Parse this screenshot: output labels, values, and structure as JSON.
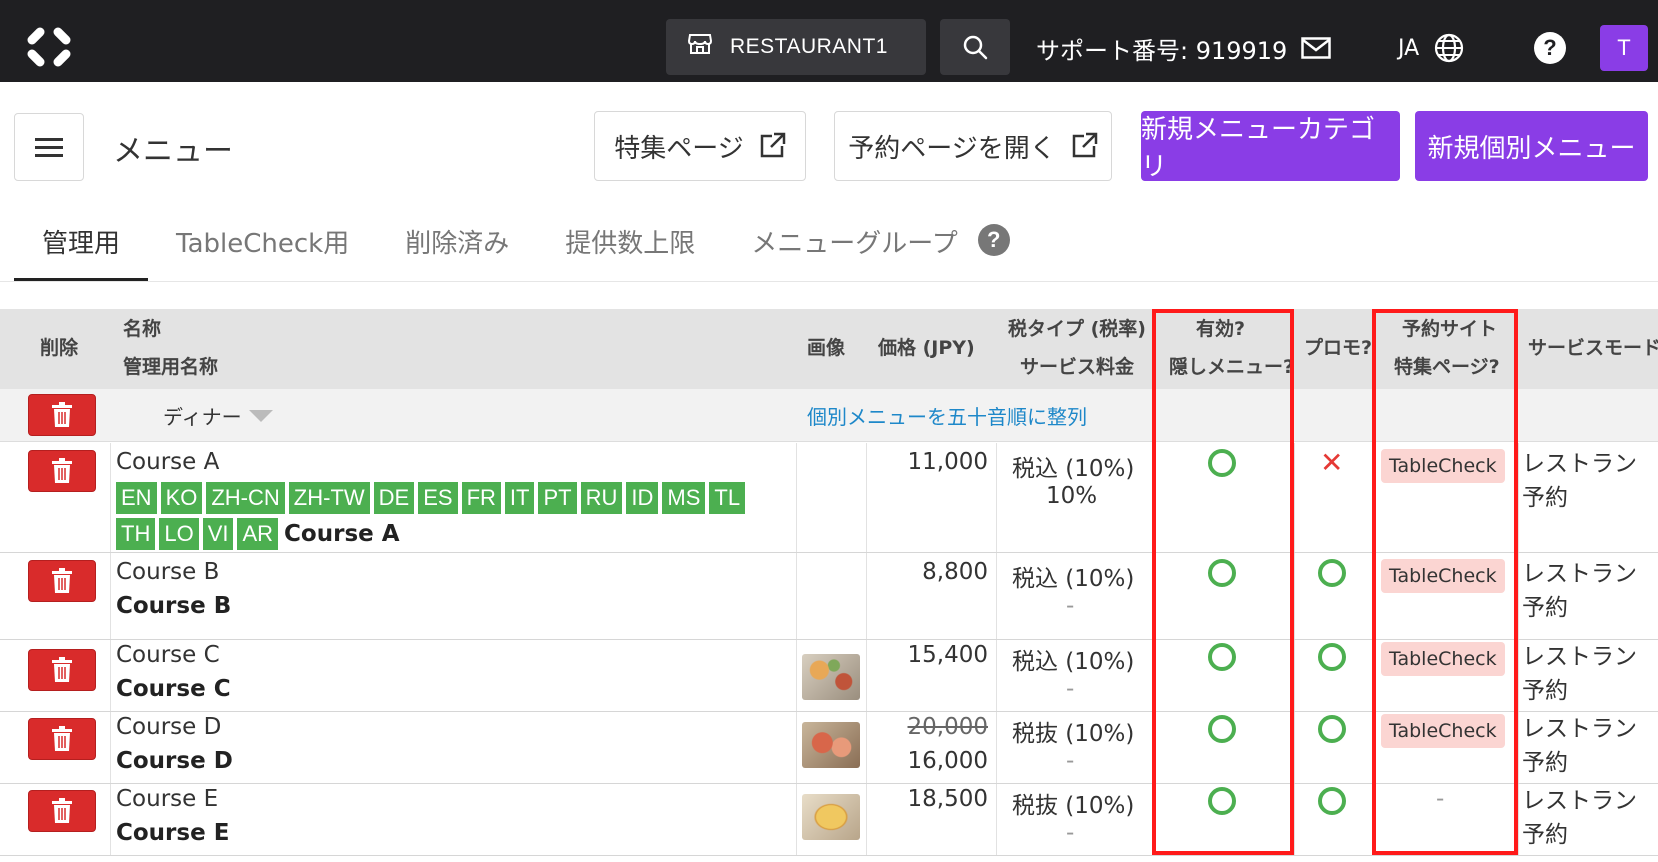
{
  "topbar": {
    "store": "RESTAURANT1",
    "support": "サポート番号: 919919",
    "lang": "JA",
    "help": "?",
    "avatar": "T"
  },
  "header": {
    "title": "メニュー",
    "feature_page": "特集ページ",
    "open_booking": "予約ページを開く",
    "new_category": "新規メニューカテゴリ",
    "new_item": "新規個別メニュー"
  },
  "tabs": [
    "管理用",
    "TableCheck用",
    "削除済み",
    "提供数上限",
    "メニューグループ"
  ],
  "tab_help": "?",
  "table": {
    "headers": {
      "delete": "削除",
      "name": "名称",
      "admin_name": "管理用名称",
      "image": "画像",
      "price": "価格 (JPY)",
      "tax_type": "税タイプ (税率)",
      "service_fee": "サービス料金",
      "active": "有効?",
      "hidden": "隠しメニュー?",
      "promo": "プロモ?",
      "booking_site": "予約サイト",
      "feature_page": "特集ページ?",
      "service_mode": "サービスモード"
    },
    "category": {
      "name": "ディナー",
      "sort_link": "個別メニューを五十音順に整列"
    },
    "rows": [
      {
        "name": "Course A",
        "admin_name": "Course A",
        "langs": [
          "EN",
          "KO",
          "ZH-CN",
          "ZH-TW",
          "DE",
          "ES",
          "FR",
          "IT",
          "PT",
          "RU",
          "ID",
          "MS",
          "TL",
          "TH",
          "LO",
          "VI",
          "AR"
        ],
        "price": "11,000",
        "tax": "税込 (10%)",
        "fee": "10%",
        "promo": "no",
        "site": "TableCheck",
        "mode": "レストラン予約"
      },
      {
        "name": "Course B",
        "admin_name": "Course B",
        "price": "8,800",
        "tax": "税込 (10%)",
        "fee": "-",
        "promo": "yes",
        "site": "TableCheck",
        "mode": "レストラン予約"
      },
      {
        "name": "Course C",
        "admin_name": "Course C",
        "price": "15,400",
        "tax": "税込 (10%)",
        "fee": "-",
        "promo": "yes",
        "site": "TableCheck",
        "mode": "レストラン予約"
      },
      {
        "name": "Course D",
        "admin_name": "Course D",
        "old_price": "20,000",
        "price": "16,000",
        "tax": "税抜 (10%)",
        "fee": "-",
        "promo": "yes",
        "site": "TableCheck",
        "mode": "レストラン予約"
      },
      {
        "name": "Course E",
        "admin_name": "Course E",
        "price": "18,500",
        "tax": "税抜 (10%)",
        "fee": "-",
        "promo": "yes",
        "site": "-",
        "mode": "レストラン予約"
      }
    ]
  },
  "colors": {
    "topbar": "#1f1f22",
    "accent_purple": "#8a3de6",
    "delete_red": "#d92b2b",
    "lang_badge_green": "#4caf50",
    "highlight_red": "#ff1a1a"
  }
}
